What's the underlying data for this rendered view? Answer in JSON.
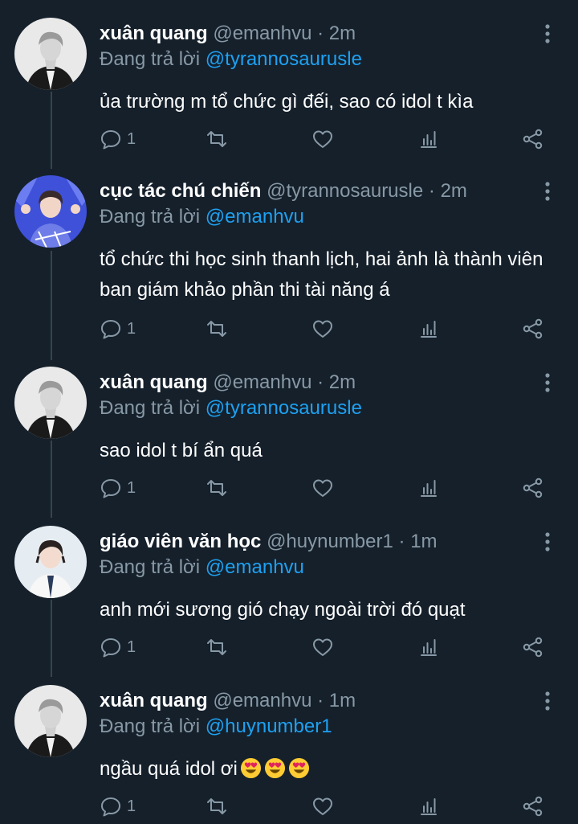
{
  "reply_prefix": "Đang trả lời",
  "tweets": [
    {
      "name": "xuân quang",
      "handle": "@emanhvu",
      "dot": "·",
      "time": "2m",
      "reply_to": "@tyrannosaurusle",
      "text": "ủa trường m tổ chức gì đếi, sao có idol t kìa",
      "reply_count": "1"
    },
    {
      "name": "cục tác chú chiến",
      "handle": "@tyrannosaurusle",
      "dot": "·",
      "time": "2m",
      "reply_to": "@emanhvu",
      "text": "tổ chức thi học sinh thanh lịch, hai ảnh là thành viên ban giám khảo phần thi tài năng á",
      "reply_count": "1"
    },
    {
      "name": "xuân quang",
      "handle": "@emanhvu",
      "dot": "·",
      "time": "2m",
      "reply_to": "@tyrannosaurusle",
      "text": "sao idol t bí ẩn quá",
      "reply_count": "1"
    },
    {
      "name": "giáo viên văn học",
      "handle": "@huynumber1",
      "dot": "·",
      "time": "1m",
      "reply_to": "@emanhvu",
      "text": "anh mới sương gió chạy ngoài trời đó quạt",
      "reply_count": "1"
    },
    {
      "name": "xuân quang",
      "handle": "@emanhvu",
      "dot": "·",
      "time": "1m",
      "reply_to": "@huynumber1",
      "text": "ngầu quá idol ơi",
      "emoji": "smiling-face-with-heart-eyes",
      "reply_count": "1"
    }
  ],
  "colors": {
    "background": "#15202b",
    "text": "#ffffff",
    "secondary": "#8899a6",
    "link": "#1da1f2",
    "thread_line": "#38444d"
  }
}
